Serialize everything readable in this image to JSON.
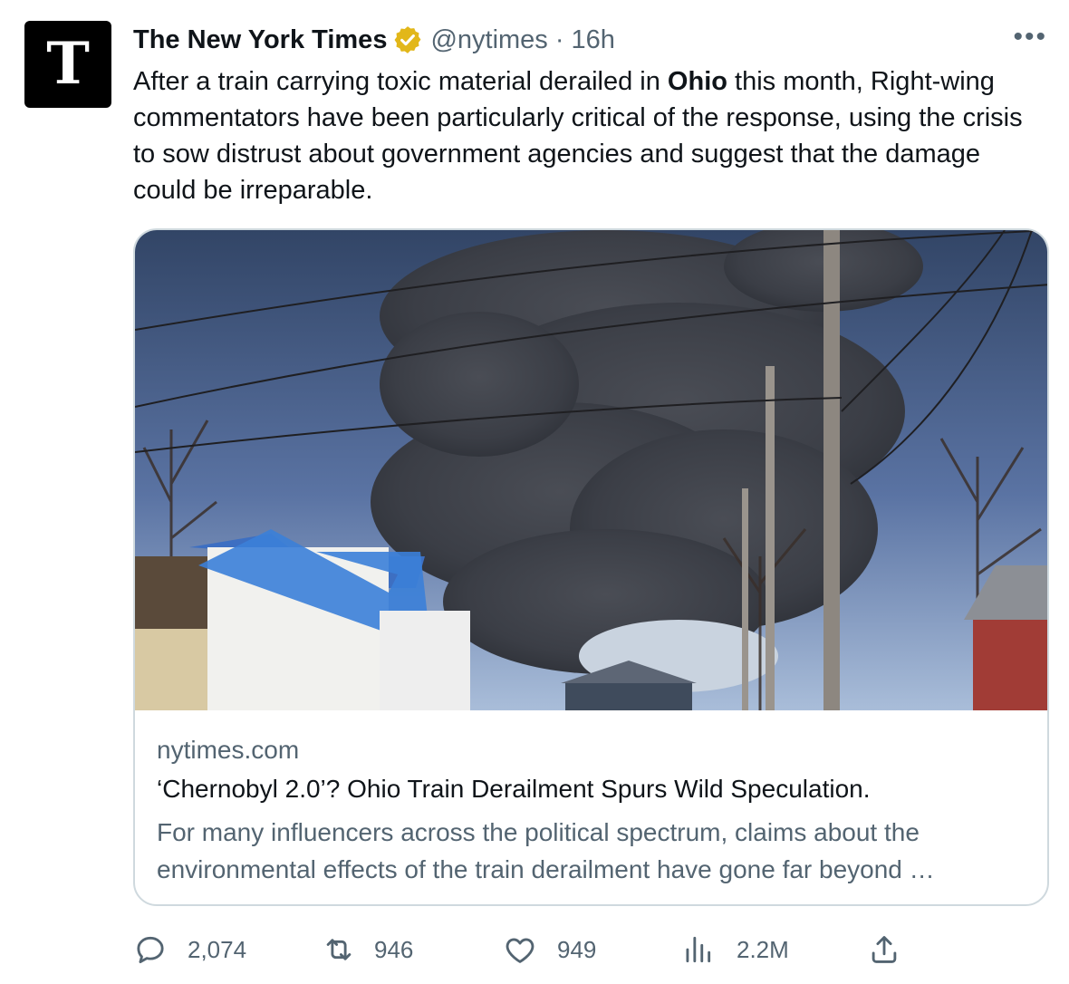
{
  "tweet": {
    "avatar_glyph": "T",
    "author": "The New York Times",
    "handle": "@nytimes",
    "separator": "·",
    "time": "16h",
    "more_label": "•••",
    "text_before": "After a train carrying toxic material derailed in ",
    "text_bold": "Ohio",
    "text_after": " this month, Right-wing commentators have been particularly critical of the response, using the crisis to sow distrust about government agencies and suggest that the damage could be irreparable."
  },
  "card": {
    "domain": "nytimes.com",
    "title": "‘Chernobyl 2.0’? Ohio Train Derailment Spurs Wild Speculation.",
    "description": "For many influencers across the political spectrum, claims about the environmental effects of the train derailment have gone far beyond …"
  },
  "actions": {
    "replies": "2,074",
    "retweets": "946",
    "likes": "949",
    "views": "2.2M"
  },
  "colors": {
    "text_primary": "#0f1419",
    "text_secondary": "#536471",
    "border": "#cfd9de",
    "verified_gold": "#e2b719"
  },
  "icons": [
    "verified-badge-icon",
    "more-icon",
    "reply-icon",
    "retweet-icon",
    "like-icon",
    "views-icon",
    "share-icon"
  ]
}
